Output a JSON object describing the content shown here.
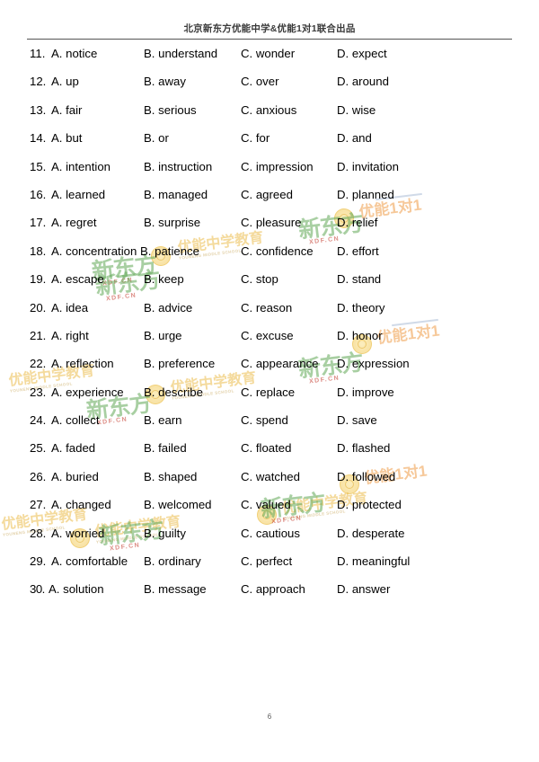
{
  "document": {
    "header_title": "北京新东方优能中学&优能1对1联合出品",
    "page_number": "6"
  },
  "watermarks": {
    "brand_green": "新东方",
    "brand_domain": "XDF.CN",
    "brand_yellow": "优能中学教育",
    "brand_yellow_sub": "YOUNENG MIDDLE SCHOOL",
    "brand_orange": "优能1对1",
    "colors": {
      "green": "#60a856",
      "red": "#c43e30",
      "yellow": "#e9b230",
      "orange": "#ed9234"
    }
  },
  "questions": [
    {
      "number": "11.",
      "a": "A. notice",
      "b": "B. understand",
      "c": "C. wonder",
      "d": "D. expect"
    },
    {
      "number": "12.",
      "a": "A. up",
      "b": "B. away",
      "c": "C. over",
      "d": "D. around"
    },
    {
      "number": "13.",
      "a": "A. fair",
      "b": "B. serious",
      "c": "C. anxious",
      "d": "D. wise"
    },
    {
      "number": "14.",
      "a": "A. but",
      "b": "B. or",
      "c": "C. for",
      "d": "D. and"
    },
    {
      "number": "15.",
      "a": "A. intention",
      "b": "B. instruction",
      "c": "C. impression",
      "d": "D. invitation"
    },
    {
      "number": "16.",
      "a": "A. learned",
      "b": "B. managed",
      "c": "C. agreed",
      "d": "D. planned"
    },
    {
      "number": "17.",
      "a": "A. regret",
      "b": "B. surprise",
      "c": "C. pleasure",
      "d": "D. relief"
    },
    {
      "number": "18.",
      "a": "A. concentration",
      "b": "B. patience",
      "c": "C. confidence",
      "d": "D. effort"
    },
    {
      "number": "19.",
      "a": "A. escape",
      "b": "B. keep",
      "c": "C. stop",
      "d": "D. stand"
    },
    {
      "number": "20.",
      "a": "A. idea",
      "b": "B. advice",
      "c": "C. reason",
      "d": "D. theory"
    },
    {
      "number": "21.",
      "a": "A. right",
      "b": "B. urge",
      "c": "C. excuse",
      "d": "D. honor"
    },
    {
      "number": "22.",
      "a": "A. reflection",
      "b": "B. preference",
      "c": "C. appearance",
      "d": "D. expression"
    },
    {
      "number": "23.",
      "a": "A. experience",
      "b": "B. describe",
      "c": "C. replace",
      "d": "D. improve"
    },
    {
      "number": "24.",
      "a": "A. collect",
      "b": "B. earn",
      "c": "C. spend",
      "d": "D. save"
    },
    {
      "number": "25.",
      "a": "A. faded",
      "b": "B. failed",
      "c": "C. floated",
      "d": "D. flashed"
    },
    {
      "number": "26.",
      "a": "A. buried",
      "b": "B. shaped",
      "c": "C. watched",
      "d": "D. followed"
    },
    {
      "number": "27.",
      "a": "A. changed",
      "b": "B. welcomed",
      "c": "C. valued",
      "d": "D. protected"
    },
    {
      "number": "28.",
      "a": "A. worried",
      "b": "B. guilty",
      "c": "C. cautious",
      "d": "D. desperate"
    },
    {
      "number": "29.",
      "a": "A. comfortable",
      "b": "B. ordinary",
      "c": "C. perfect",
      "d": "D. meaningful"
    },
    {
      "number": "30.",
      "a": "A. solution",
      "b": "B. message",
      "c": "C. approach",
      "d": "D. answer"
    }
  ]
}
